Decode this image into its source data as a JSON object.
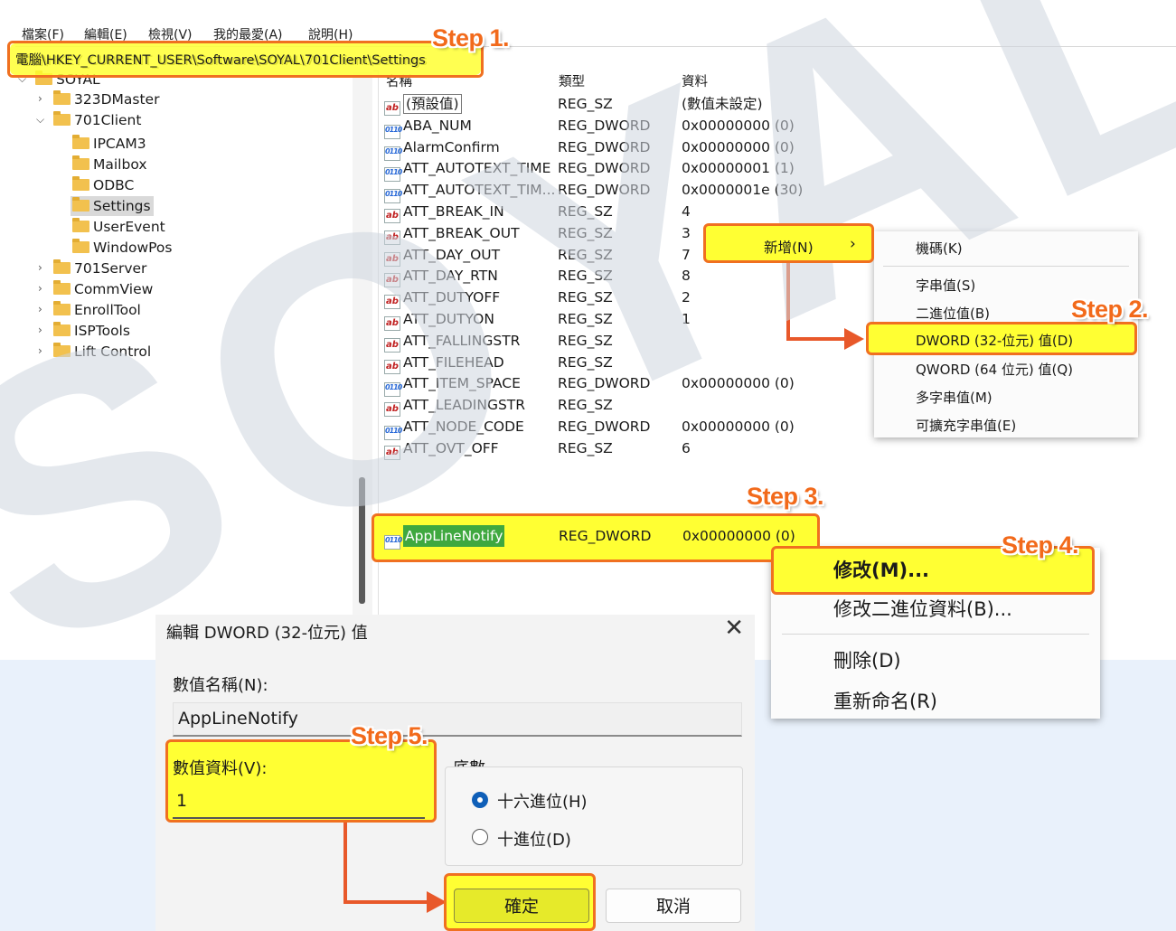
{
  "watermark": "SOYAL",
  "menubar": {
    "items": [
      "檔案(F)",
      "編輯(E)",
      "檢視(V)",
      "我的最愛(A)",
      "說明(H)"
    ]
  },
  "address": "電腦\\HKEY_CURRENT_USER\\Software\\SOYAL\\701Client\\Settings",
  "tree": [
    {
      "label": "SOYAL",
      "expanded": true
    },
    {
      "label": "323DMaster"
    },
    {
      "label": "701Client",
      "expanded": true
    },
    {
      "label": "IPCAM3"
    },
    {
      "label": "Mailbox"
    },
    {
      "label": "ODBC"
    },
    {
      "label": "Settings",
      "selected": true
    },
    {
      "label": "UserEvent"
    },
    {
      "label": "WindowPos"
    },
    {
      "label": "701Server"
    },
    {
      "label": "CommView"
    },
    {
      "label": "EnrollTool"
    },
    {
      "label": "ISPTools"
    },
    {
      "label": "Lift Control"
    }
  ],
  "columns": {
    "name": "名稱",
    "type": "類型",
    "data": "資料"
  },
  "values": [
    {
      "name": "(預設值)",
      "type": "REG_SZ",
      "data": "(數值未設定)",
      "icon": "string-icon"
    },
    {
      "name": "ABA_NUM",
      "type": "REG_DWORD",
      "data": "0x00000000 (0)",
      "icon": "dword-icon"
    },
    {
      "name": "AlarmConfirm",
      "type": "REG_DWORD",
      "data": "0x00000000 (0)",
      "icon": "dword-icon"
    },
    {
      "name": "ATT_AUTOTEXT_TIME",
      "type": "REG_DWORD",
      "data": "0x00000001 (1)",
      "icon": "dword-icon"
    },
    {
      "name": "ATT_AUTOTEXT_TIM...",
      "type": "REG_DWORD",
      "data": "0x0000001e (30)",
      "icon": "dword-icon"
    },
    {
      "name": "ATT_BREAK_IN",
      "type": "REG_SZ",
      "data": "4",
      "icon": "string-icon"
    },
    {
      "name": "ATT_BREAK_OUT",
      "type": "REG_SZ",
      "data": "3",
      "icon": "string-icon"
    },
    {
      "name": "ATT_DAY_OUT",
      "type": "REG_SZ",
      "data": "7",
      "icon": "string-icon"
    },
    {
      "name": "ATT_DAY_RTN",
      "type": "REG_SZ",
      "data": "8",
      "icon": "string-icon"
    },
    {
      "name": "ATT_DUTYOFF",
      "type": "REG_SZ",
      "data": "2",
      "icon": "string-icon"
    },
    {
      "name": "ATT_DUTYON",
      "type": "REG_SZ",
      "data": "1",
      "icon": "string-icon"
    },
    {
      "name": "ATT_FALLINGSTR",
      "type": "REG_SZ",
      "data": "",
      "icon": "string-icon"
    },
    {
      "name": "ATT_FILEHEAD",
      "type": "REG_SZ",
      "data": "",
      "icon": "string-icon"
    },
    {
      "name": "ATT_ITEM_SPACE",
      "type": "REG_DWORD",
      "data": "0x00000000 (0)",
      "icon": "dword-icon"
    },
    {
      "name": "ATT_LEADINGSTR",
      "type": "REG_SZ",
      "data": "",
      "icon": "string-icon"
    },
    {
      "name": "ATT_NODE_CODE",
      "type": "REG_DWORD",
      "data": "0x00000000 (0)",
      "icon": "dword-icon"
    },
    {
      "name": "ATT_OVT_OFF",
      "type": "REG_SZ",
      "data": "6",
      "icon": "string-icon"
    }
  ],
  "new_value": {
    "name": "AppLineNotify",
    "type": "REG_DWORD",
    "data": "0x00000000 (0)"
  },
  "context_menu_new": {
    "label": "新增(N)",
    "arrow": "›"
  },
  "submenu": {
    "items": [
      "機碼(K)",
      "字串值(S)",
      "二進位值(B)",
      "DWORD (32-位元) 值(D)",
      "QWORD (64 位元) 值(Q)",
      "多字串值(M)",
      "可擴充字串值(E)"
    ]
  },
  "context_menu_modify": {
    "items": [
      "修改(M)...",
      "修改二進位資料(B)...",
      "刪除(D)",
      "重新命名(R)"
    ]
  },
  "dialog": {
    "title": "編輯 DWORD (32-位元) 值",
    "close": "✕",
    "name_label": "數值名稱(N):",
    "name_value": "AppLineNotify",
    "data_label": "數值資料(V):",
    "data_value": "1",
    "base_label": "底數",
    "base_options": [
      "十六進位(H)",
      "十進位(D)"
    ],
    "base_selected": "十六進位(H)",
    "ok": "確定",
    "cancel": "取消"
  },
  "steps": [
    "Step 1.",
    "Step 2.",
    "Step 3.",
    "Step 4.",
    "Step 5."
  ],
  "colors": {
    "highlight": "#ffff33",
    "annotation": "#f26a1b",
    "radio_selected": "#0f5fb8"
  }
}
